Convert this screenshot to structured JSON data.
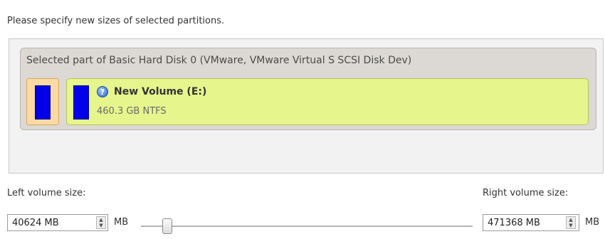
{
  "instruction": "Please specify new sizes of selected partitions.",
  "disk": {
    "title": "Selected part of Basic Hard Disk 0 (VMware, VMware Virtual S SCSI Disk Dev)"
  },
  "volume": {
    "name": "New Volume (E:)",
    "size_fs": "460.3 GB NTFS",
    "icon": "help-icon",
    "icon_glyph": "?"
  },
  "left": {
    "label": "Left volume size:",
    "value": "40624 MB",
    "unit": "MB"
  },
  "right": {
    "label": "Right volume size:",
    "value": "471368 MB",
    "unit": "MB"
  },
  "slider": {
    "position_fraction": 0.08
  },
  "colors": {
    "volume_bg": "#e6f58c",
    "unallocated_bg": "#fbd9a5",
    "partition_bar": "#0000e8"
  }
}
